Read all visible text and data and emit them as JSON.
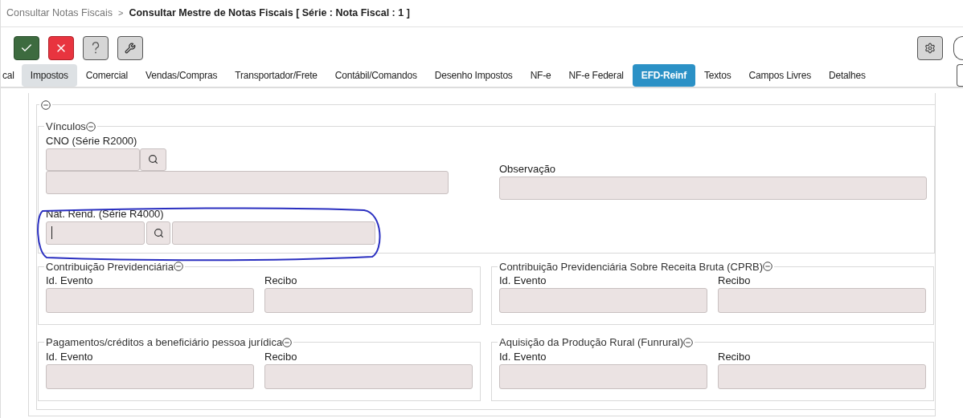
{
  "breadcrumb": {
    "parent": "Consultar Notas Fiscais",
    "separator": ">",
    "current": "Consultar Mestre de Notas Fiscais [ Série : Nota Fiscal : 1 ]"
  },
  "toolbar": [
    {
      "kind": "confirm"
    },
    {
      "kind": "cancel"
    },
    {
      "kind": "help"
    },
    {
      "kind": "tools"
    }
  ],
  "tabs": [
    {
      "label": "cal",
      "selected": false,
      "hovered": false
    },
    {
      "label": "Impostos",
      "selected": false,
      "hovered": true
    },
    {
      "label": "Comercial",
      "selected": false,
      "hovered": false
    },
    {
      "label": "Vendas/Compras",
      "selected": false,
      "hovered": false
    },
    {
      "label": "Transportador/Frete",
      "selected": false,
      "hovered": false
    },
    {
      "label": "Contábil/Comandos",
      "selected": false,
      "hovered": false
    },
    {
      "label": "Desenho Impostos",
      "selected": false,
      "hovered": false
    },
    {
      "label": "NF-e",
      "selected": false,
      "hovered": false
    },
    {
      "label": "NF-e Federal",
      "selected": false,
      "hovered": false
    },
    {
      "label": "EFD-Reinf",
      "selected": true,
      "hovered": false
    },
    {
      "label": "Textos",
      "selected": false,
      "hovered": false
    },
    {
      "label": "Campos Livres",
      "selected": false,
      "hovered": false
    },
    {
      "label": "Detalhes",
      "selected": false,
      "hovered": false
    }
  ],
  "vinculos": {
    "legend": "Vínculos",
    "cno_label": "CNO (Série R2000)",
    "observacao_label": "Observação",
    "nat_rend": {
      "label": "Nat. Rend. (Série R4000)",
      "focused": true,
      "highlighted": true
    }
  },
  "groups": [
    {
      "legend": "Contribuição Previdenciária",
      "fields": [
        "Id. Evento",
        "Recibo"
      ]
    },
    {
      "legend": "Contribuição Previdenciária Sobre Receita Bruta (CPRB)",
      "fields": [
        "Id. Evento",
        "Recibo"
      ]
    },
    {
      "legend": "Pagamentos/créditos a beneficiário pessoa jurídica",
      "fields": [
        "Id. Evento",
        "Recibo"
      ]
    },
    {
      "legend": "Aquisição da Produção Rural (Funrural)",
      "fields": [
        "Id. Evento",
        "Recibo"
      ]
    }
  ]
}
